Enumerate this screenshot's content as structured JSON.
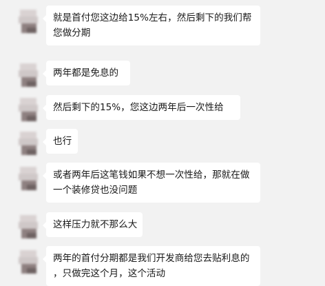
{
  "messages": [
    {
      "lines": [
        "就是首付您这边给15%左右，然后剩下的我们帮",
        "您做分期"
      ]
    },
    {
      "lines": [
        "两年都是免息的"
      ]
    },
    {
      "lines": [
        "然后剩下的15%，您这边两年后一次性给"
      ]
    },
    {
      "lines": [
        "也行"
      ]
    },
    {
      "lines": [
        "或者两年后这笔钱如果不想一次性给，那就在做",
        "一个装修贷也没问题"
      ]
    },
    {
      "lines": [
        "这样压力就不那么大"
      ]
    },
    {
      "lines": [
        "两年的首付分期都是我们开发商给您去贴利息的",
        "，只做完这个月，这个活动"
      ]
    }
  ]
}
